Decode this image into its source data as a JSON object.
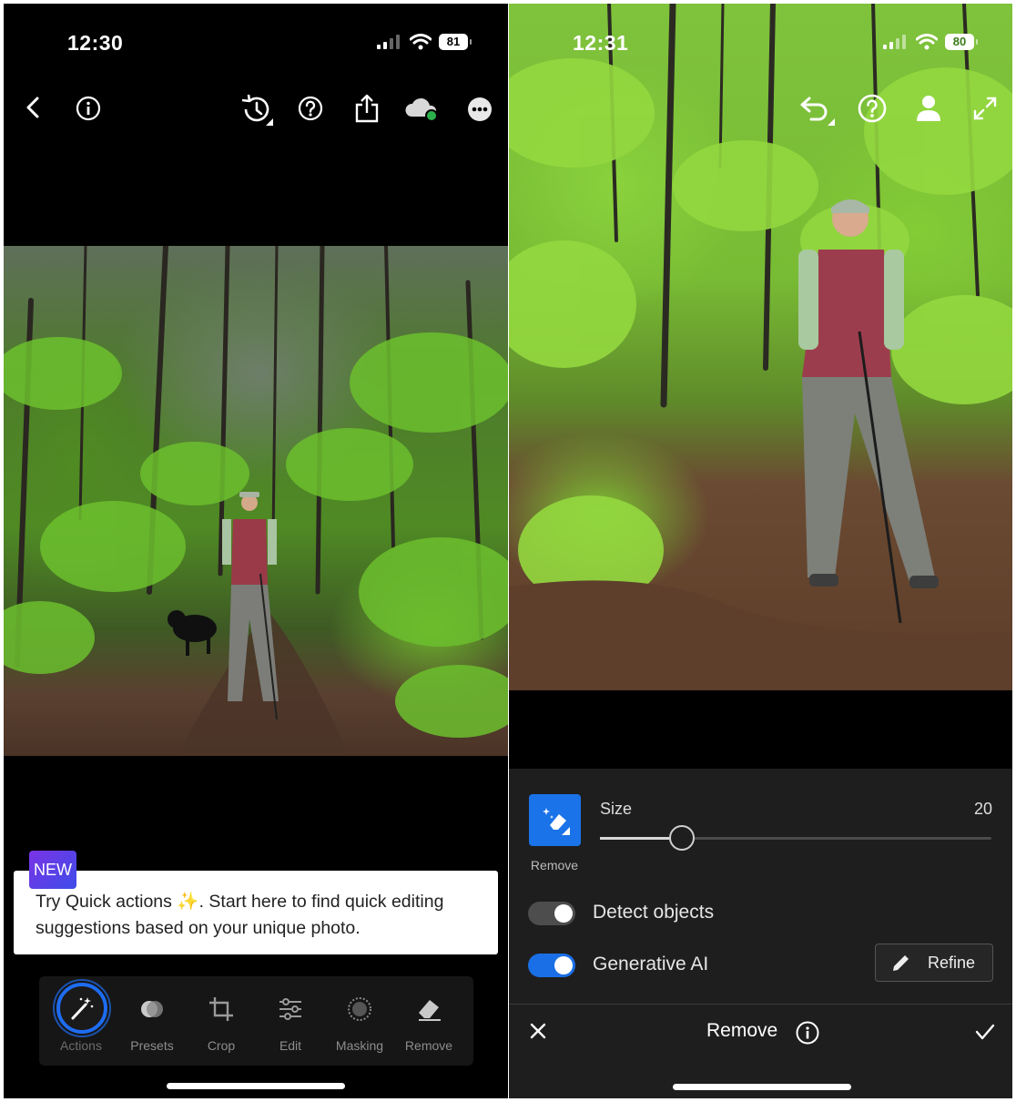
{
  "left_screen": {
    "status": {
      "time": "12:30",
      "battery": "81"
    },
    "toolbar": {
      "back": "back-icon",
      "info": "info-icon",
      "history": "history-icon",
      "help": "help-icon",
      "share": "share-icon",
      "cloud": "cloud-sync-icon",
      "more": "more-icon"
    },
    "new_badge": "NEW",
    "tooltip": "Try Quick actions ✨. Start here to find quick editing suggestions based on your unique photo.",
    "tabs": [
      {
        "label": "Actions",
        "icon": "magic-wand-icon"
      },
      {
        "label": "Presets",
        "icon": "presets-icon"
      },
      {
        "label": "Crop",
        "icon": "crop-icon"
      },
      {
        "label": "Edit",
        "icon": "sliders-icon"
      },
      {
        "label": "Masking",
        "icon": "masking-icon"
      },
      {
        "label": "Remove",
        "icon": "eraser-icon"
      }
    ],
    "colors": {
      "active_ring": "#1e6cf0",
      "badge_gradient_start": "#7a33e6",
      "badge_gradient_end": "#3e4de8"
    }
  },
  "right_screen": {
    "status": {
      "time": "12:31",
      "battery": "80"
    },
    "toolbar": {
      "undo": "undo-icon",
      "help": "help-icon",
      "person": "person-icon",
      "expand": "expand-icon"
    },
    "tool": {
      "label": "Remove",
      "icon": "eraser-sparkle-icon"
    },
    "size": {
      "label": "Size",
      "value": "20",
      "level": 0.21
    },
    "detect_objects": {
      "label": "Detect objects",
      "on": false
    },
    "generative_ai": {
      "label": "Generative AI",
      "on": true
    },
    "refine_label": "Refine",
    "footer": {
      "title": "Remove",
      "cancel": "close-icon",
      "confirm": "checkmark-icon"
    },
    "colors": {
      "accent": "#1a73e8",
      "toggle_on": "#1a6fe6"
    }
  }
}
